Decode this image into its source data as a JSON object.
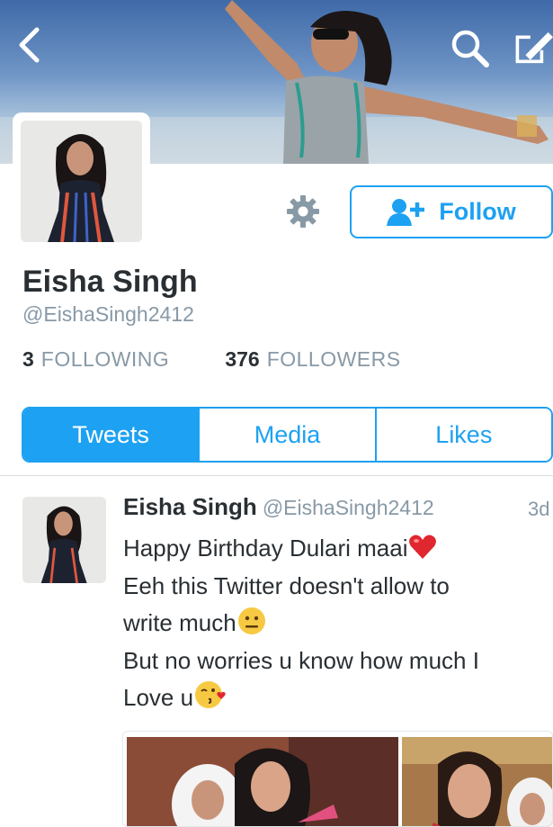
{
  "profile": {
    "name": "Eisha Singh",
    "handle": "@EishaSingh2412",
    "follow_label": "Follow"
  },
  "stats": [
    {
      "count": "3",
      "label": "FOLLOWING"
    },
    {
      "count": "376",
      "label": "FOLLOWERS"
    }
  ],
  "tabs": [
    {
      "label": "Tweets",
      "active": true
    },
    {
      "label": "Media",
      "active": false
    },
    {
      "label": "Likes",
      "active": false
    }
  ],
  "tweet": {
    "name": "Eisha Singh",
    "handle": "@EishaSingh2412",
    "time": "3d",
    "lines": [
      "Happy Birthday Dulari maai",
      "Eeh this Twitter doesn't allow to",
      "write much",
      "But no worries u know how much I",
      "Love u"
    ]
  },
  "icons": [
    "back-icon",
    "search-icon",
    "compose-icon",
    "gear-icon",
    "add-user-icon",
    "red-heart-emoji",
    "neutral-face-emoji",
    "kissing-face-emoji"
  ],
  "colors": {
    "accent": "#1da1f2",
    "text": "#292f33",
    "muted": "#8899a6"
  }
}
